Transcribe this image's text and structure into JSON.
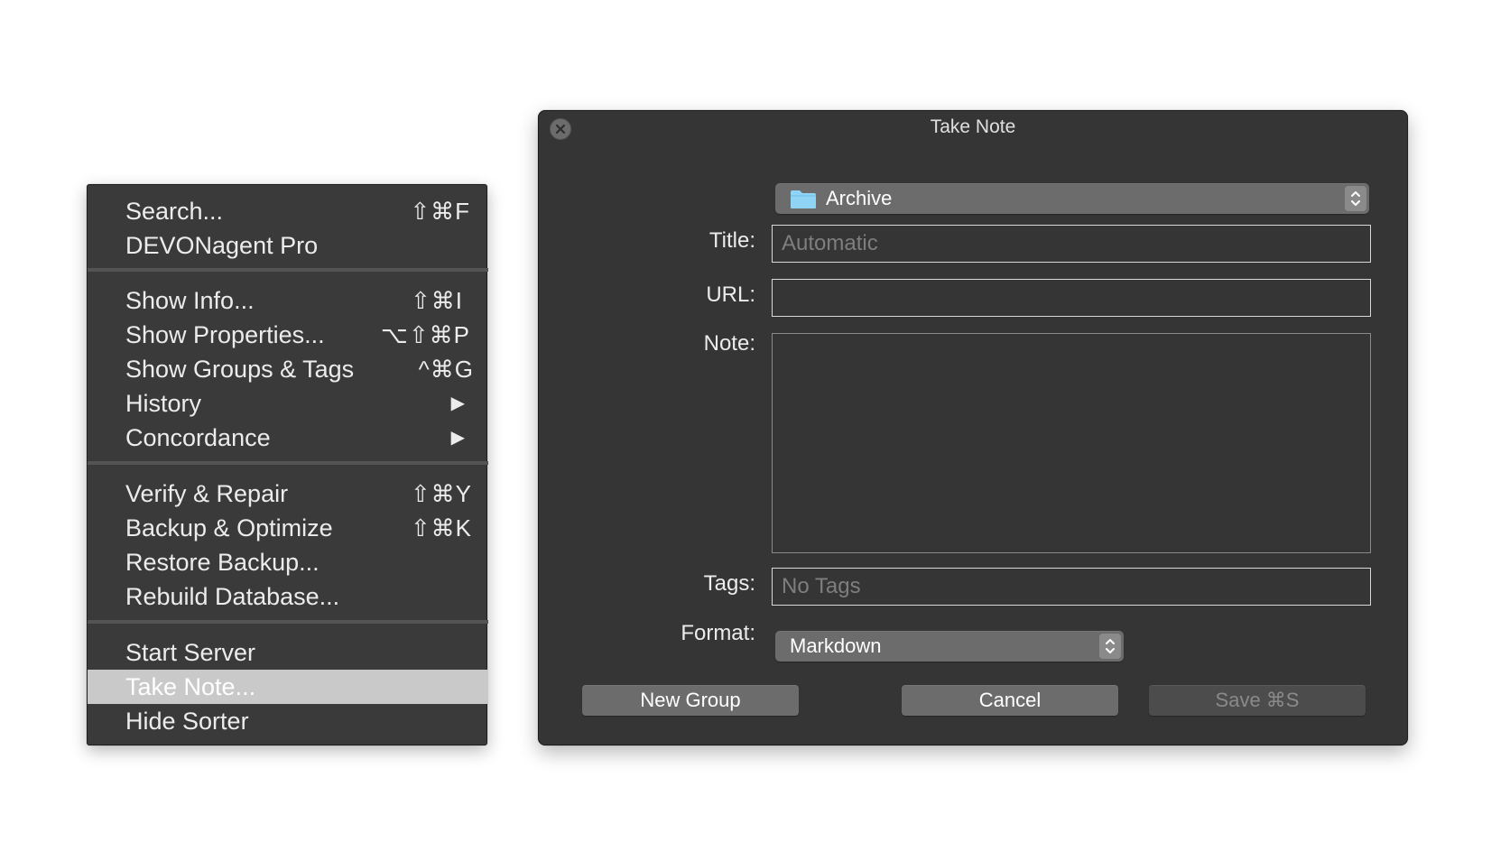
{
  "menu": {
    "items": [
      {
        "label": "Search...",
        "shortcut": "⇧⌘F"
      },
      {
        "label": "DEVONagent Pro",
        "shortcut": ""
      },
      {
        "label": "Show Info...",
        "shortcut": "⇧⌘I"
      },
      {
        "label": "Show Properties...",
        "shortcut": "⌥⇧⌘P"
      },
      {
        "label": "Show Groups & Tags",
        "shortcut": "^⌘G"
      },
      {
        "label": "History",
        "shortcut": "▶"
      },
      {
        "label": "Concordance",
        "shortcut": "▶"
      },
      {
        "label": "Verify & Repair",
        "shortcut": "⇧⌘Y"
      },
      {
        "label": "Backup & Optimize",
        "shortcut": "⇧⌘K"
      },
      {
        "label": "Restore Backup...",
        "shortcut": ""
      },
      {
        "label": "Rebuild Database...",
        "shortcut": ""
      },
      {
        "label": "Start Server",
        "shortcut": ""
      },
      {
        "label": "Take Note...",
        "shortcut": ""
      },
      {
        "label": "Hide Sorter",
        "shortcut": ""
      }
    ],
    "highlighted": "Take Note..."
  },
  "dialog": {
    "title": "Take Note",
    "destination": {
      "value": "Archive",
      "icon": "folder-icon",
      "icon_color": "#8fd3f5"
    },
    "title_field": {
      "label": "Title:",
      "value": "",
      "placeholder": "Automatic"
    },
    "url_field": {
      "label": "URL:",
      "value": ""
    },
    "note_field": {
      "label": "Note:",
      "value": ""
    },
    "tags_field": {
      "label": "Tags:",
      "value": "",
      "placeholder": "No Tags"
    },
    "format": {
      "label": "Format:",
      "value": "Markdown"
    },
    "buttons": {
      "new_group": "New Group",
      "cancel": "Cancel",
      "save": "Save ⌘S"
    }
  },
  "colors": {
    "menu_background": "#3a3a3a",
    "menu_highlight": "#c9c9c9",
    "dialog_background": "#353535",
    "control_gray": "#6c6c6c"
  }
}
